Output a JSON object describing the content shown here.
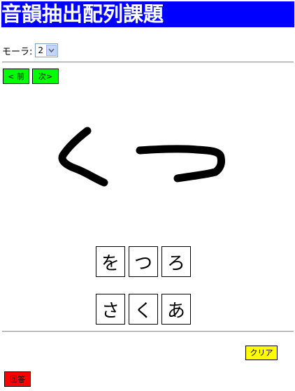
{
  "title": "音韻抽出配列課題",
  "mora": {
    "label": "モーラ:",
    "selected": "2"
  },
  "nav": {
    "prev_label": "< 前",
    "next_label": "次>"
  },
  "tiles_row1": [
    "を",
    "つ",
    "ろ"
  ],
  "tiles_row2": [
    "さ",
    "く",
    "あ"
  ],
  "clear_label": "クリア",
  "answer_label": "回答",
  "colors": {
    "title_bg": "#0000ff",
    "nav_buttons": "#00ff00",
    "clear_button": "#ffff00",
    "answer_button": "#ff0000"
  }
}
